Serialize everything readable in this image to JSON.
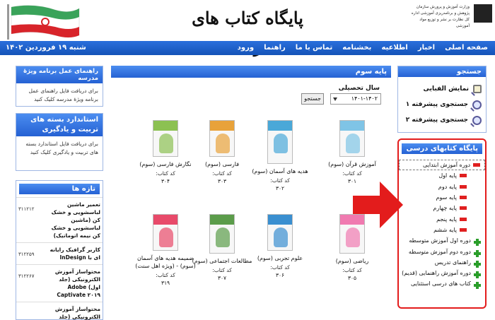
{
  "header": {
    "site_title": "پایگاه کتاب های درسی",
    "org_text": "وزارت آموزش و پرورش سازمان پژوهش و برنامه‌ریزی آموزشی اداره کل نظارت بر نشر و توزیع مواد آموزشی"
  },
  "nav": {
    "items": [
      "صفحه اصلی",
      "اخبار",
      "اطلاعیه",
      "بخشنامه",
      "تماس با ما",
      "راهنما",
      "ورود"
    ]
  },
  "date": "شنبه ۱۹ فروردین ۱۴۰۲",
  "search_box": {
    "title": "جستجو",
    "links": [
      "نمایش الفبایی",
      "جستجوی پیشرفته ۱",
      "جستجوی پیشرفته ۲"
    ]
  },
  "books_box": {
    "title": "پایگاه کتابهای درسی",
    "items": [
      {
        "label": "دوره آموزش ابتدایی",
        "type": "minus",
        "level": 0
      },
      {
        "label": "پایه اول",
        "type": "dash",
        "level": 1
      },
      {
        "label": "پایه دوم",
        "type": "dash",
        "level": 1
      },
      {
        "label": "پایه سوم",
        "type": "dash",
        "level": 1
      },
      {
        "label": "پایه چهارم",
        "type": "dash",
        "level": 1
      },
      {
        "label": "پایه پنجم",
        "type": "dash",
        "level": 1
      },
      {
        "label": "پایه ششم",
        "type": "dash",
        "level": 1
      },
      {
        "label": "دوره اول آموزش متوسطه",
        "type": "plus",
        "level": 0
      },
      {
        "label": "دوره دوم آموزش متوسطه",
        "type": "plus",
        "level": 0
      },
      {
        "label": "راهنمای تدریس",
        "type": "plus",
        "level": 0
      },
      {
        "label": "دوره آموزش راهنمایی (قدیم)",
        "type": "plus",
        "level": 0
      },
      {
        "label": "کتاب های درسی استثنایی",
        "type": "plus",
        "level": 0
      }
    ]
  },
  "main": {
    "heading": "پایه سوم",
    "year_label": "سال تحصیلی",
    "year_value": "۱۴۰۱-۱۴۰۲",
    "search_button": "جستجو",
    "code_label": "کد کتاب:",
    "books": [
      {
        "title": "آموزش قرآن (سوم)",
        "code": "۳۰۱",
        "color": "#7fc4e6"
      },
      {
        "title": "هدیه های آسمان (سوم)",
        "code": "۳۰۲",
        "color": "#4aa8d8"
      },
      {
        "title": "فارسی (سوم)",
        "code": "۳۰۳",
        "color": "#e8a23a"
      },
      {
        "title": "نگارش فارسی (سوم)",
        "code": "۳۰۴",
        "color": "#8cc152"
      },
      {
        "title": "ریاضی (سوم)",
        "code": "۳۰۵",
        "color": "#f07ab0"
      },
      {
        "title": "علوم تجربی (سوم)",
        "code": "۳۰۶",
        "color": "#3a8fd0"
      },
      {
        "title": "مطالعات اجتماعی (سوم)",
        "code": "۳۰۷",
        "color": "#5b9c4a"
      },
      {
        "title": "ضمیمه هدیه های آسمان (سوم) - (ویژه اهل سنت)",
        "code": "۳۱۹",
        "color": "#e84a6a"
      }
    ]
  },
  "left": {
    "guide_title": "راهنمای عمل برنامه ویژۀ مدرسه",
    "guide_text": "برای دریافت فایل راهنمای عمل برنامه ویژۀ مدرسه کلیک کنید",
    "std_title": "استاندارد بسته های تربیت و یادگیری",
    "std_text": "برای دریافت فایل استاندارد بسته های تربیت و یادگیری کلیک کنید",
    "news_title": "تازه ها",
    "news": [
      {
        "title": "تعمیر ماشین لباسشویی و خشک کن (ماشین لباسشویی و خشک کن نیمه اتوماتیک)",
        "id": "۳۱۱۲۱۲"
      },
      {
        "title": "کاربر گرافیک رایانه ای با InDesign",
        "id": "۳۱۲۲۵۹"
      },
      {
        "title": "محتواساز آموزش الکترونیکی (جلد اول) Adobe Captivate ۲۰۱۹",
        "id": "۳۱۲۲۶۷"
      },
      {
        "title": "محتواساز آموزش الکترونیکی (جلد دوم) Adobe",
        "id": ""
      }
    ]
  }
}
